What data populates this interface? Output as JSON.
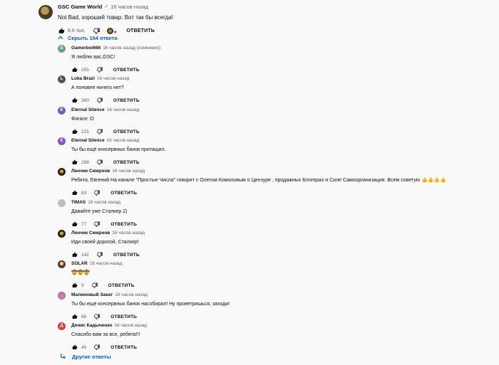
{
  "top": {
    "author": "GSC Game World",
    "verified_icon": "check-icon",
    "time": "16 часов назад",
    "text": "Not Bad, хороший товар. Вот так бы всегда!",
    "likes": "8,6 тыс.",
    "reply_label": "ОТВЕТИТЬ"
  },
  "toggle": {
    "label": "Скрыть 164 ответа"
  },
  "replies": [
    {
      "avatar_letter": "G",
      "author": "Gamerboi666",
      "time": "16 часов назад (изменено)",
      "text": "Я люблю вас,GSC!",
      "likes": "265",
      "reply_label": "ОТВЕТИТЬ"
    },
    {
      "avatar_letter": "L",
      "author": "Luka Brazi",
      "time": "16 часов назад",
      "text": "А поновее ничего нет?",
      "likes": "360",
      "reply_label": "ОТВЕТИТЬ"
    },
    {
      "avatar_letter": "E",
      "author": "Eternal Silence",
      "time": "16 часов назад",
      "text": "Фигасе :D",
      "likes": "125",
      "reply_label": "ОТВЕТИТЬ"
    },
    {
      "avatar_letter": "E",
      "author": "Eternal Silence",
      "time": "16 часов назад",
      "text": "Ты бы ещё консервных банок притащил.",
      "likes": "298",
      "reply_label": "ОТВЕТИТЬ"
    },
    {
      "avatar_letter": "",
      "author": "Ленчик Смирнов",
      "time": "16 часов назад",
      "text": "Ребята, Евгений На канале \"Простые Числа\" говорит с Олегом Комоловым о Цензуре , продажных Блогерах и Силе Самоорганизации. Всем советую 👍👍👍👍",
      "likes": "83",
      "reply_label": "ОТВЕТИТЬ"
    },
    {
      "avatar_letter": "",
      "author": "TIMAS",
      "time": "16 часов назад",
      "text": "Давайте уже Сталкер 2)",
      "likes": "77",
      "reply_label": "ОТВЕТИТЬ"
    },
    {
      "avatar_letter": "",
      "author": "Ленчик Смирнов",
      "time": "16 часов назад",
      "text": "Иди своей дорогой, Сталкер!",
      "likes": "142",
      "reply_label": "ОТВЕТИТЬ"
    },
    {
      "avatar_letter": "",
      "author": "SOLAR",
      "time": "16 часов назад",
      "text": "🤠🤠🤠",
      "likes": "9",
      "reply_label": "ОТВЕТИТЬ"
    },
    {
      "avatar_letter": "",
      "author": "Малиновый Закат",
      "time": "16 часов назад",
      "text": "Ты бы ещё консервных банок насобирал! Ну проветришься, заходи!",
      "likes": "88",
      "reply_label": "ОТВЕТИТЬ"
    },
    {
      "avatar_letter": "Д",
      "author": "Денис Кадыченко",
      "time": "16 часов назад",
      "text": "Спасибо вам за все, ребята!!!",
      "likes": "40",
      "reply_label": "ОТВЕТИТЬ"
    }
  ],
  "other_replies": {
    "label": "Другие ответы"
  },
  "colors": {
    "link": "#065fd4",
    "secondary_text": "#606060",
    "background": "#f9f9f9"
  }
}
